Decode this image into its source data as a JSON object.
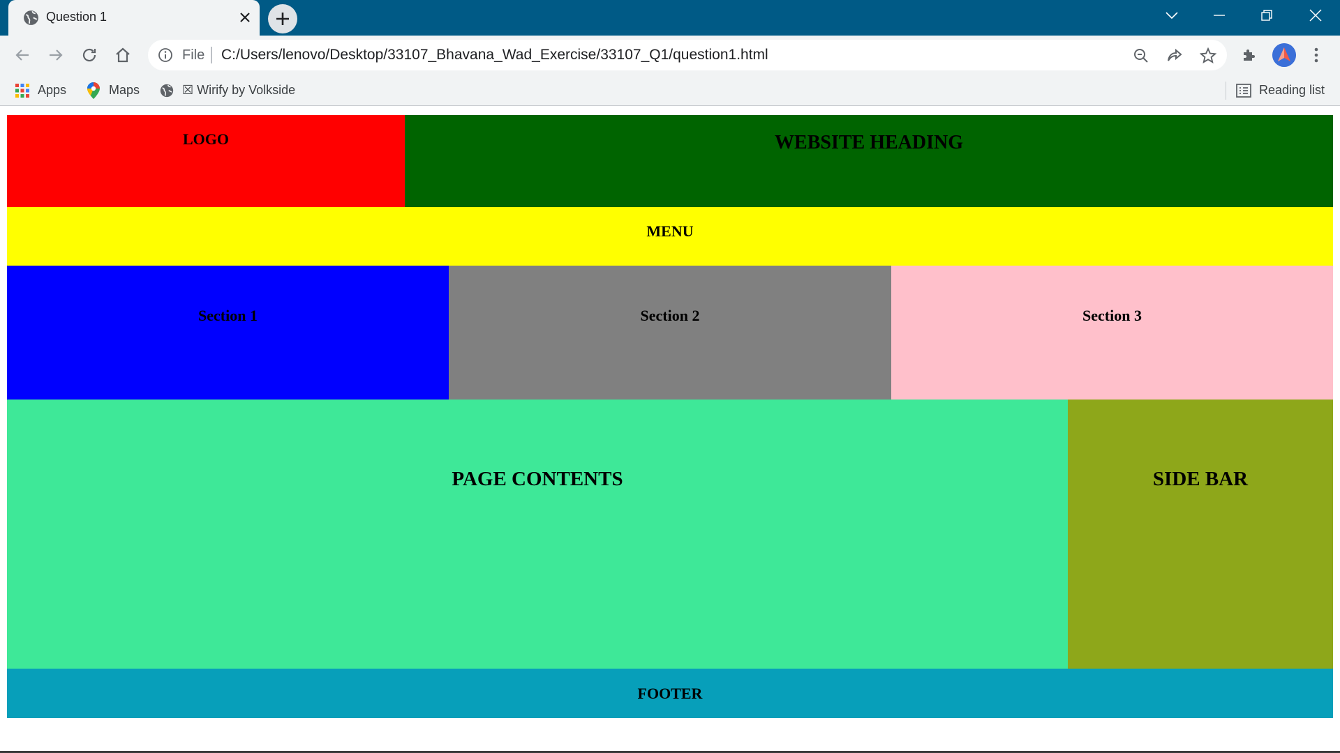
{
  "browser": {
    "tab": {
      "title": "Question 1",
      "icon": "globe-icon"
    },
    "address_bar": {
      "scheme_label": "File",
      "url": "C:/Users/lenovo/Desktop/33107_Bhavana_Wad_Exercise/33107_Q1/question1.html"
    },
    "bookmarks": [
      {
        "label": "Apps",
        "icon": "apps-grid-icon"
      },
      {
        "label": "Maps",
        "icon": "maps-pin-icon"
      },
      {
        "label": "☒ Wirify by Volkside",
        "icon": "globe-icon"
      }
    ],
    "reading_list": "Reading list"
  },
  "page": {
    "logo": "LOGO",
    "heading": "WEBSITE HEADING",
    "menu": "MENU",
    "sections": [
      "Section 1",
      "Section 2",
      "Section 3"
    ],
    "content": "PAGE CONTENTS",
    "sidebar": "SIDE BAR",
    "footer": "FOOTER"
  },
  "colors": {
    "titlebar": "#005a86",
    "logo": "#ff0000",
    "heading": "#006400",
    "menu": "#ffff00",
    "section1": "#0000ff",
    "section2": "#808080",
    "section3": "#ffc0cb",
    "content": "#3ee898",
    "sidebar": "#8ea71a",
    "footer": "#079fba"
  }
}
